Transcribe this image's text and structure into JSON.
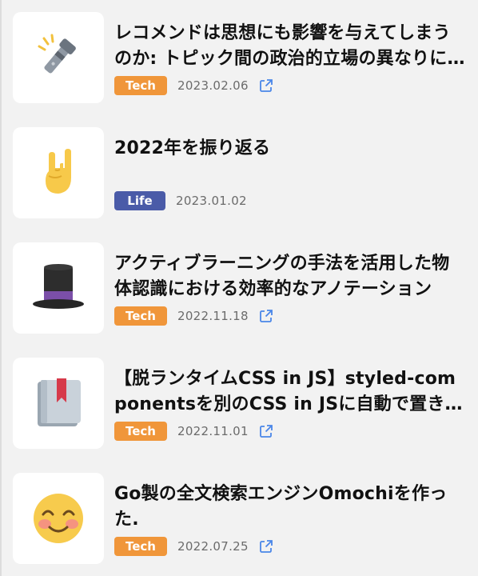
{
  "colors": {
    "tech_tag": "#f0963a",
    "life_tag": "#4a5ba8",
    "link_icon": "#4a86e8"
  },
  "articles": [
    {
      "icon": "flashlight-icon",
      "title": "レコメンドは思想にも影響を与えてしまうのか: トピック間の政治的立場の異なりに関する研究",
      "tag": "Tech",
      "tag_color": "#f0963a",
      "date": "2023.02.06"
    },
    {
      "icon": "rock-hand-icon",
      "title": "2022年を振り返る",
      "tag": "Life",
      "tag_color": "#4a5ba8",
      "date": "2023.01.02"
    },
    {
      "icon": "top-hat-icon",
      "title": "アクティブラーニングの手法を活用した物体認識における効率的なアノテーション",
      "tag": "Tech",
      "tag_color": "#f0963a",
      "date": "2022.11.18"
    },
    {
      "icon": "bookmark-book-icon",
      "title": "【脱ランタイムCSS in JS】styled-componentsを別のCSS in JSに自動で置き換える",
      "tag": "Tech",
      "tag_color": "#f0963a",
      "date": "2022.11.01"
    },
    {
      "icon": "smiling-face-icon",
      "title": "Go製の全文検索エンジンOmochiを作った.",
      "tag": "Tech",
      "tag_color": "#f0963a",
      "date": "2022.07.25"
    }
  ]
}
